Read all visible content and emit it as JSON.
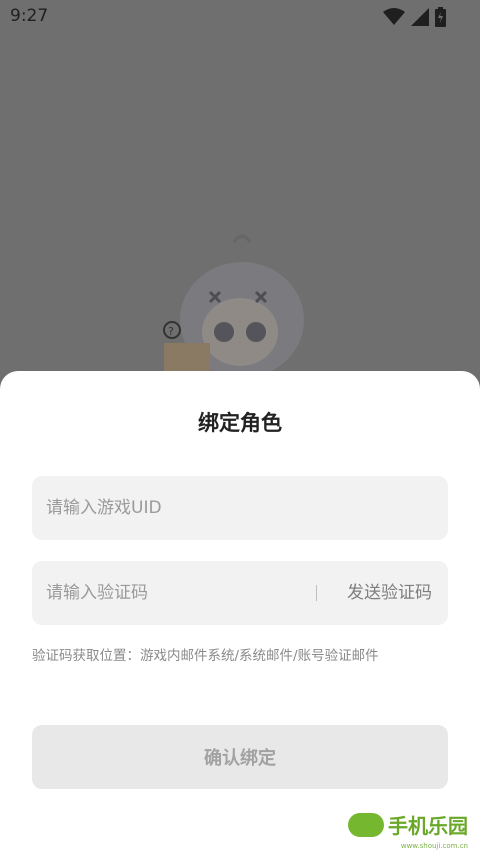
{
  "status_bar": {
    "time": "9:27",
    "icons": [
      "wifi-icon",
      "signal-icon",
      "battery-icon"
    ]
  },
  "background": {
    "overlay_color": "#6f6f6f",
    "illustration": "anime-character-icon"
  },
  "sheet": {
    "title": "绑定角色",
    "uid_field": {
      "placeholder": "请输入游戏UID",
      "value": ""
    },
    "code_field": {
      "placeholder": "请输入验证码",
      "value": ""
    },
    "send_code_label": "发送验证码",
    "hint": "验证码获取位置：游戏内邮件系统/系统邮件/账号验证邮件",
    "confirm_label": "确认绑定",
    "accent_text_color": "#7e7e7e"
  },
  "watermark": {
    "text": "手机乐园",
    "subtext": "www.shouji.com.cn"
  }
}
